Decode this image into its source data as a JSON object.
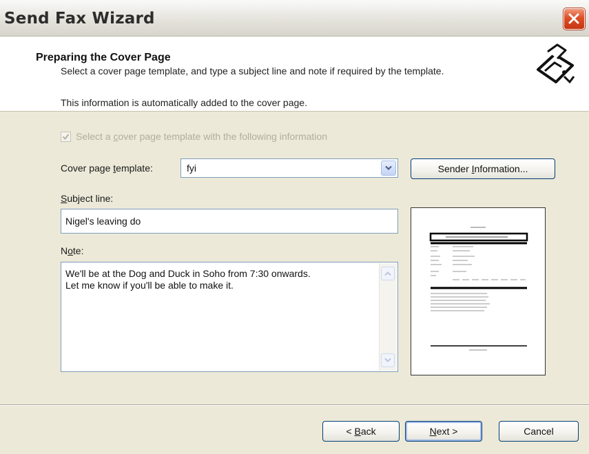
{
  "window": {
    "title": "Send Fax Wizard"
  },
  "header": {
    "title": "Preparing the Cover Page",
    "subtitle": "Select a cover page template, and type a subject line and note if required by the template.",
    "subtitle2": "This information is automatically added to the cover page."
  },
  "form": {
    "checkbox_pre": "Select a ",
    "checkbox_u": "c",
    "checkbox_post": "over page template with the following information",
    "checkbox_checked": true,
    "template_label_pre": "Cover page ",
    "template_label_u": "t",
    "template_label_post": "emplate:",
    "template_value": "fyi",
    "sender_btn_pre": "Sender ",
    "sender_btn_u": "I",
    "sender_btn_post": "nformation...",
    "subject_label_u": "S",
    "subject_label_post": "ubject line:",
    "subject_value": "Nigel's leaving do",
    "note_label_pre": "N",
    "note_label_u": "o",
    "note_label_post": "te:",
    "note_value": "We'll be at the Dog and Duck in Soho from 7:30 onwards.\nLet me know if you'll be able to make it."
  },
  "footer": {
    "back_pre": "< ",
    "back_u": "B",
    "back_post": "ack",
    "next_u": "N",
    "next_post": "ext >",
    "cancel": "Cancel"
  },
  "icons": {
    "close": "close-icon",
    "fax": "fax-machine-icon",
    "dropdown": "chevron-down-icon",
    "scroll_up": "scroll-up-arrow-icon",
    "scroll_down": "scroll-down-arrow-icon"
  }
}
